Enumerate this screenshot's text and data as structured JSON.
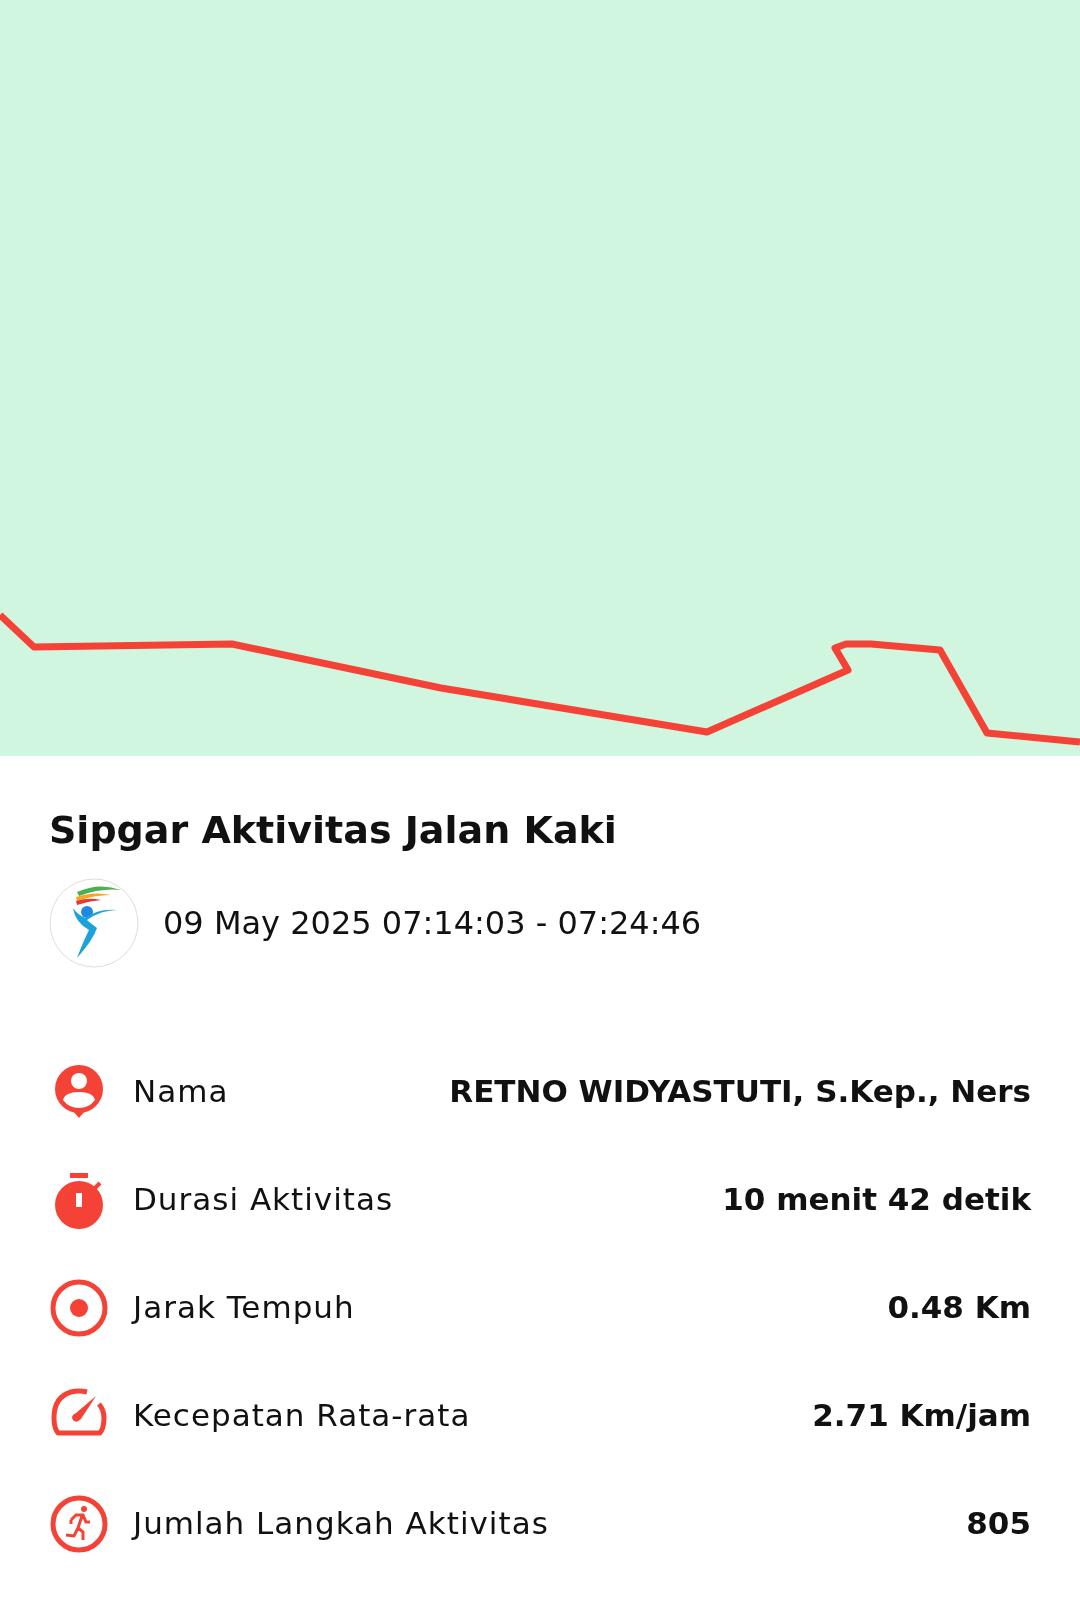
{
  "activity": {
    "title": "Sipgar Aktivitas Jalan Kaki",
    "datetime": "09 May 2025 07:14:03 - 07:24:46"
  },
  "details": [
    {
      "kind": "person",
      "label": "Nama",
      "value": "RETNO WIDYASTUTI, S.Kep., Ners"
    },
    {
      "kind": "timer",
      "label": "Durasi Aktivitas",
      "value": "10 menit 42 detik"
    },
    {
      "kind": "distance",
      "label": "Jarak Tempuh",
      "value": "0.48 Km"
    },
    {
      "kind": "speed",
      "label": "Kecepatan Rata-rata",
      "value": "2.71 Km/jam"
    },
    {
      "kind": "steps",
      "label": "Jumlah Langkah Aktivitas",
      "value": "805"
    }
  ]
}
